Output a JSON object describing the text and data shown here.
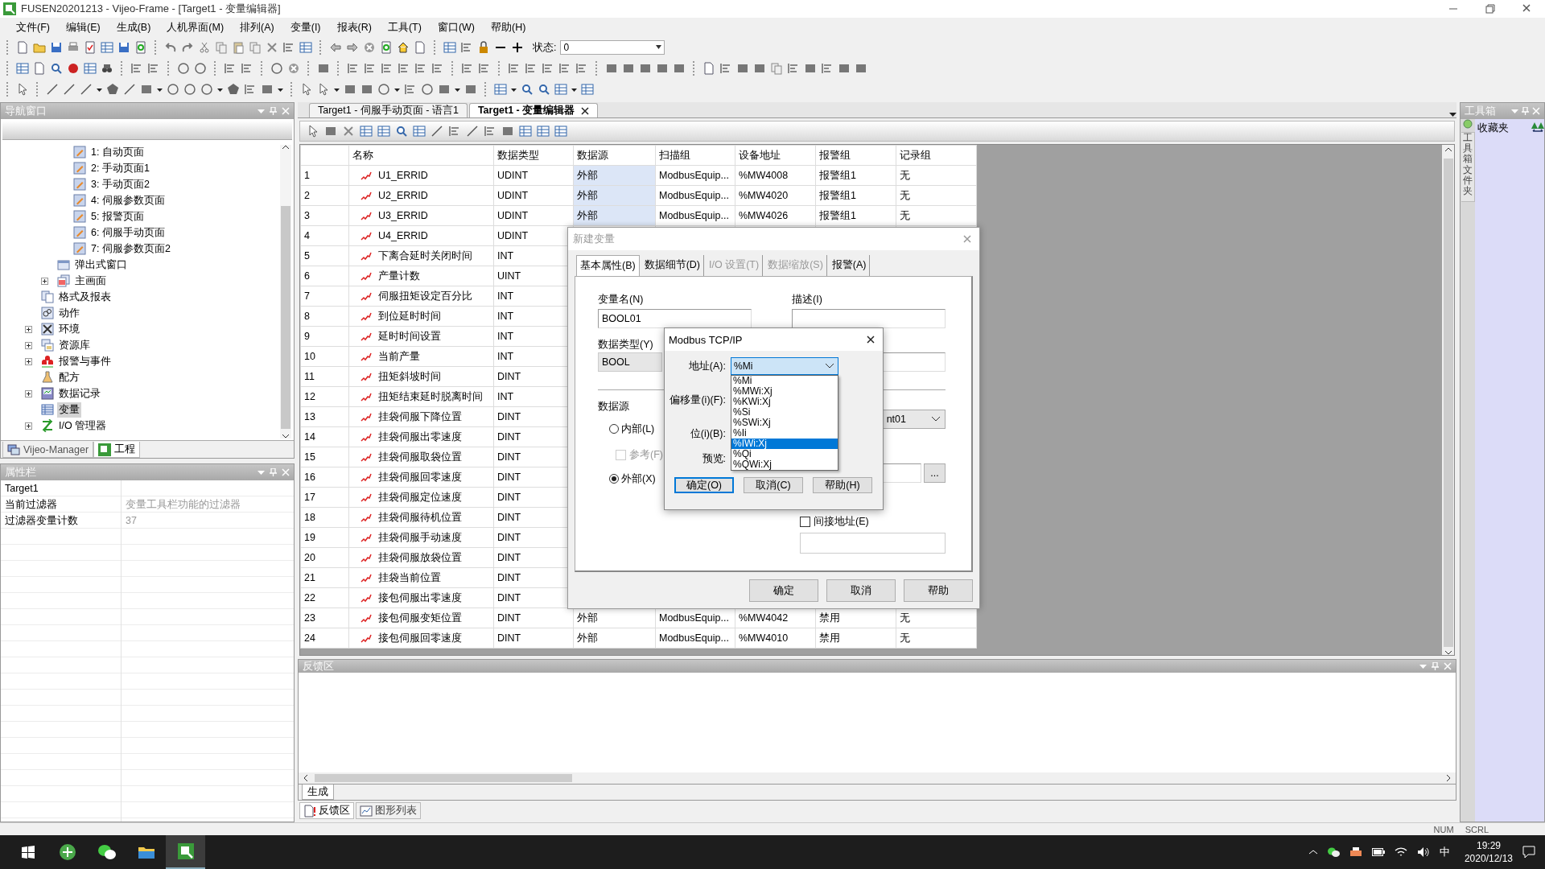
{
  "window": {
    "title": "FUSEN20201213 - Vijeo-Frame - [Target1 - 变量编辑器]"
  },
  "menu": [
    "文件(F)",
    "编辑(E)",
    "生成(B)",
    "人机界面(M)",
    "排列(A)",
    "变量(I)",
    "报表(R)",
    "工具(T)",
    "窗口(W)",
    "帮助(H)"
  ],
  "toolbar": {
    "status_label": "状态:",
    "status_value": "0"
  },
  "navigator": {
    "title": "导航窗口",
    "tree": [
      {
        "kind": "group",
        "children": [
          {
            "kind": "group",
            "children": [
              {
                "label": "1: 自动页面",
                "kind": "page",
                "collapsed": false,
                "selected": false
              },
              {
                "label": "2: 手动页面1",
                "kind": "page",
                "collapsed": false,
                "selected": false
              },
              {
                "label": "3: 手动页面2",
                "kind": "page",
                "collapsed": false,
                "selected": false
              },
              {
                "label": "4: 伺服参数页面",
                "kind": "page",
                "collapsed": false,
                "selected": false
              },
              {
                "label": "5: 报警页面",
                "kind": "page",
                "collapsed": false,
                "selected": false
              },
              {
                "label": "6: 伺服手动页面",
                "kind": "page",
                "collapsed": false,
                "selected": false
              },
              {
                "label": "7: 伺服参数页面2",
                "kind": "page",
                "collapsed": false,
                "selected": false
              }
            ]
          },
          {
            "label": "弹出式窗口",
            "kind": "popup",
            "collapsed": false,
            "selected": false
          },
          {
            "label": "主画面",
            "kind": "screens",
            "collapsed": true,
            "selected": false
          }
        ]
      },
      {
        "label": "格式及报表",
        "kind": "report",
        "collapsed": false,
        "selected": false
      },
      {
        "label": "动作",
        "kind": "action",
        "collapsed": false,
        "selected": false
      },
      {
        "label": "环境",
        "kind": "env",
        "collapsed": true,
        "selected": false
      },
      {
        "label": "资源库",
        "kind": "library",
        "collapsed": true,
        "selected": false
      },
      {
        "label": "报警与事件",
        "kind": "alarm",
        "collapsed": true,
        "selected": false
      },
      {
        "label": "配方",
        "kind": "recipe",
        "collapsed": false,
        "selected": false
      },
      {
        "label": "数据记录",
        "kind": "datalog",
        "collapsed": true,
        "selected": false
      },
      {
        "label": "变量",
        "kind": "variable",
        "collapsed": false,
        "selected": true
      },
      {
        "label": "I/O 管理器",
        "kind": "io",
        "collapsed": true,
        "selected": false
      }
    ],
    "tabs": [
      {
        "label": "Vijeo-Manager",
        "selected": false
      },
      {
        "label": "工程",
        "selected": true
      }
    ]
  },
  "properties": {
    "title": "属性栏",
    "rows": [
      {
        "name": "Target1"
      },
      {
        "name": "当前过滤器",
        "value": "变量工具栏功能的过滤器"
      },
      {
        "name": "过滤器变量计数",
        "value": "37"
      }
    ]
  },
  "document_tabs": [
    {
      "label": "Target1 - 伺服手动页面 - 语言1",
      "selected": false
    },
    {
      "label": "Target1 - 变量编辑器",
      "selected": true
    }
  ],
  "table": {
    "columns": [
      "名称",
      "数据类型",
      "数据源",
      "扫描组",
      "设备地址",
      "报警组",
      "记录组"
    ],
    "rows": [
      {
        "no": "1",
        "cells": [
          "U1_ERRID",
          "UDINT",
          "外部",
          "ModbusEquip...",
          "%MW4008",
          "报警组1",
          "无"
        ],
        "highlighted": true
      },
      {
        "no": "2",
        "cells": [
          "U2_ERRID",
          "UDINT",
          "外部",
          "ModbusEquip...",
          "%MW4020",
          "报警组1",
          "无"
        ],
        "highlighted": true
      },
      {
        "no": "3",
        "cells": [
          "U3_ERRID",
          "UDINT",
          "外部",
          "ModbusEquip...",
          "%MW4026",
          "报警组1",
          "无"
        ],
        "highlighted": true
      },
      {
        "no": "4",
        "cells": [
          "U4_ERRID",
          "UDINT"
        ]
      },
      {
        "no": "5",
        "cells": [
          "下离合延时关闭时间",
          "INT"
        ]
      },
      {
        "no": "6",
        "cells": [
          "产量计数",
          "UINT"
        ]
      },
      {
        "no": "7",
        "cells": [
          "伺服扭矩设定百分比",
          "INT"
        ]
      },
      {
        "no": "8",
        "cells": [
          "到位延时时间",
          "INT"
        ]
      },
      {
        "no": "9",
        "cells": [
          "延时时间设置",
          "INT"
        ]
      },
      {
        "no": "10",
        "cells": [
          "当前产量",
          "INT"
        ]
      },
      {
        "no": "11",
        "cells": [
          "扭矩斜坡时间",
          "DINT"
        ]
      },
      {
        "no": "12",
        "cells": [
          "扭矩结束延时脱离时间",
          "INT"
        ]
      },
      {
        "no": "13",
        "cells": [
          "挂袋伺服下降位置",
          "DINT"
        ]
      },
      {
        "no": "14",
        "cells": [
          "挂袋伺服出零速度",
          "DINT"
        ]
      },
      {
        "no": "15",
        "cells": [
          "挂袋伺服取袋位置",
          "DINT"
        ]
      },
      {
        "no": "16",
        "cells": [
          "挂袋伺服回零速度",
          "DINT"
        ]
      },
      {
        "no": "17",
        "cells": [
          "挂袋伺服定位速度",
          "DINT"
        ]
      },
      {
        "no": "18",
        "cells": [
          "挂袋伺服待机位置",
          "DINT"
        ]
      },
      {
        "no": "19",
        "cells": [
          "挂袋伺服手动速度",
          "DINT"
        ]
      },
      {
        "no": "20",
        "cells": [
          "挂袋伺服放袋位置",
          "DINT"
        ]
      },
      {
        "no": "21",
        "cells": [
          "挂袋当前位置",
          "DINT"
        ]
      },
      {
        "no": "22",
        "cells": [
          "接包伺服出零速度",
          "DINT"
        ]
      },
      {
        "no": "23",
        "cells": [
          "接包伺服变矩位置",
          "DINT",
          "外部",
          "ModbusEquip...",
          "%MW4042",
          "禁用",
          "无"
        ],
        "highlighted": false
      },
      {
        "no": "24",
        "cells": [
          "接包伺服回零速度",
          "DINT",
          "外部",
          "ModbusEquip...",
          "%MW4010",
          "禁用",
          "无"
        ],
        "highlighted": false
      }
    ]
  },
  "new_variable_dialog": {
    "title": "新建变量",
    "tabs": [
      {
        "label": "基本属性(B)",
        "selected": true,
        "disabled": false
      },
      {
        "label": "数据细节(D)",
        "selected": false,
        "disabled": false
      },
      {
        "label": "I/O 设置(T)",
        "selected": false,
        "disabled": true
      },
      {
        "label": "数据缩放(S)",
        "selected": false,
        "disabled": true
      },
      {
        "label": "报警(A)",
        "selected": false,
        "disabled": false
      }
    ],
    "name_label": "变量名(N)",
    "name_value": "BOOL01",
    "description_label": "描述(I)",
    "type_label": "数据类型(Y)",
    "type_value": "BOOL",
    "source_label": "数据源",
    "sources": [
      {
        "label": "内部(L)",
        "selected": false
      },
      {
        "label": "外部(X)",
        "selected": true
      }
    ],
    "reference": {
      "label": "参考(F)",
      "checked": false,
      "disabled": true
    },
    "device_value": "nt01",
    "browse_button": "...",
    "indirect": {
      "label": "间接地址(E)",
      "checked": false
    },
    "buttons": [
      "确定",
      "取消",
      "帮助"
    ]
  },
  "modbus_dialog": {
    "title": "Modbus TCP/IP",
    "address_label": "地址(A):",
    "address_value": "%Mi",
    "options": [
      {
        "label": "%Mi",
        "selected": false
      },
      {
        "label": "%MWi:Xj",
        "selected": false
      },
      {
        "label": "%KWi:Xj",
        "selected": false
      },
      {
        "label": "%Si",
        "selected": false
      },
      {
        "label": "%SWi:Xj",
        "selected": false
      },
      {
        "label": "%Ii",
        "selected": false
      },
      {
        "label": "%IWi:Xj",
        "selected": true
      },
      {
        "label": "%Qi",
        "selected": false
      },
      {
        "label": "%QWi:Xj",
        "selected": false
      }
    ],
    "offset_label": "偏移量(i)(F):",
    "bit_label": "位(i)(B):",
    "preview_label": "预览:",
    "buttons": [
      {
        "label": "确定(O)",
        "default": true
      },
      {
        "label": "取消(C)",
        "default": false
      },
      {
        "label": "帮助(H)",
        "default": false
      }
    ]
  },
  "feedback": {
    "title": "反馈区",
    "tabs": [
      {
        "label": "生成",
        "selected": true
      }
    ]
  },
  "bottom_tabs": [
    {
      "label": "反馈区",
      "selected": true
    },
    {
      "label": "图形列表",
      "selected": false
    }
  ],
  "toolbox": {
    "title": "工具箱",
    "side_tab": "工具箱文件夹",
    "header": "收藏夹"
  },
  "status_bar": [
    "NUM",
    "SCRL"
  ],
  "taskbar": {
    "input_method": "中",
    "time": "19:29",
    "date": "2020/12/13"
  }
}
